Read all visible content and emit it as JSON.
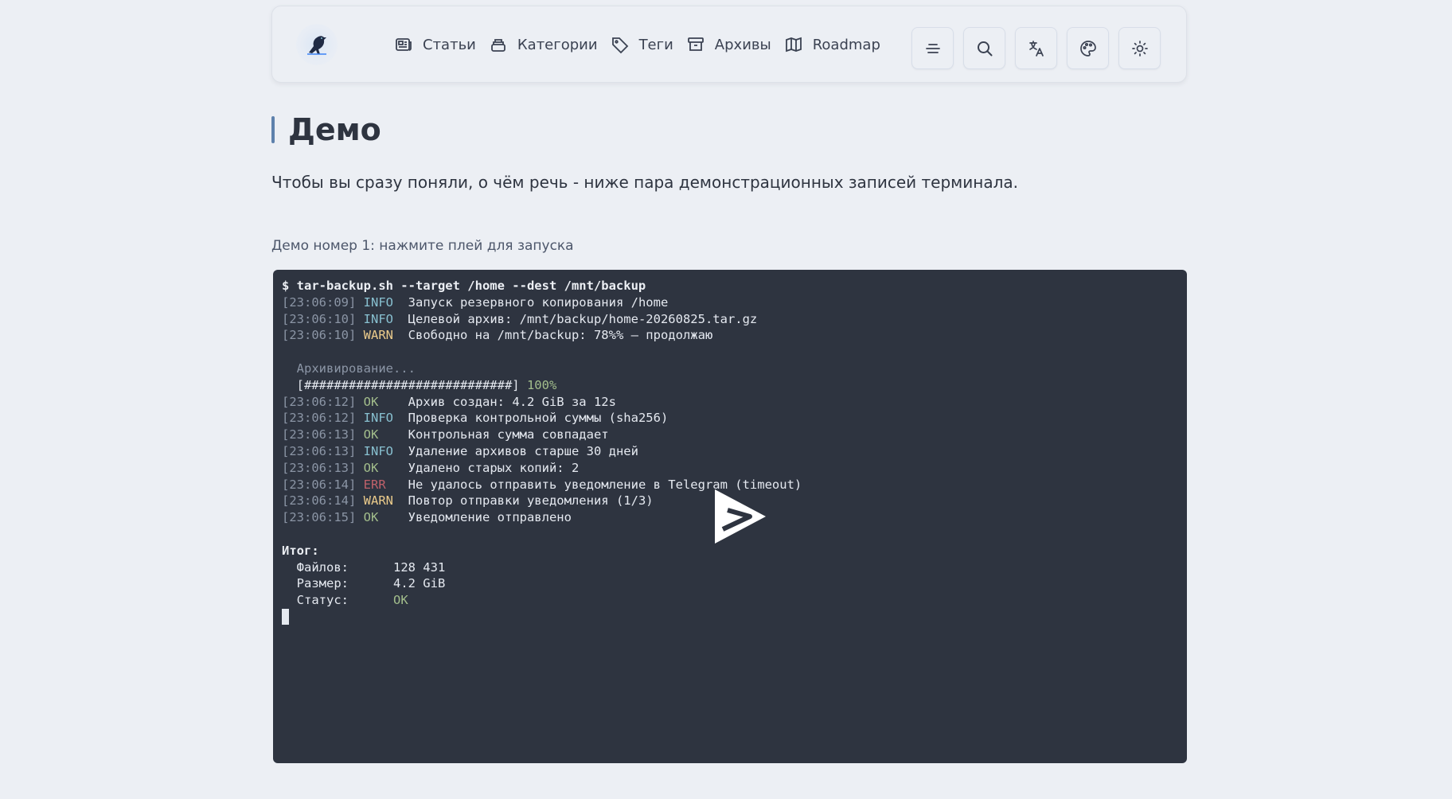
{
  "nav": {
    "items": [
      {
        "label": "Статьи",
        "icon": "article-icon"
      },
      {
        "label": "Категории",
        "icon": "stack-icon"
      },
      {
        "label": "Теги",
        "icon": "tag-icon"
      },
      {
        "label": "Архивы",
        "icon": "archive-icon"
      },
      {
        "label": "Roadmap",
        "icon": "map-icon"
      }
    ]
  },
  "tools": [
    "menu-lines-icon",
    "search-icon",
    "translate-icon",
    "palette-icon",
    "sun-icon"
  ],
  "page": {
    "title": "Демо",
    "lead": "Чтобы вы сразу поняли, о чём речь - ниже пара демонстрационных записей терминала.",
    "demo_caption": "Демо номер 1: нажмите плей для запуска"
  },
  "terminal": {
    "command": "$ tar-backup.sh --target /home --dest /mnt/backup",
    "log1": [
      {
        "ts": "[23:06:09]",
        "level": "INFO",
        "cls": "info",
        "msg": "Запуск резервного копирования /home"
      },
      {
        "ts": "[23:06:10]",
        "level": "INFO",
        "cls": "info",
        "msg": "Целевой архив: /mnt/backup/home-20260825.tar.gz"
      },
      {
        "ts": "[23:06:10]",
        "level": "WARN",
        "cls": "warn",
        "msg": "Свободно на /mnt/backup: 78%% — продолжаю"
      }
    ],
    "archiving": "  Архивирование...",
    "progress_bar": "  [############################]",
    "progress_pct": "100%",
    "log2": [
      {
        "ts": "[23:06:12]",
        "level": "OK",
        "cls": "ok",
        "msg": "Архив создан: 4.2 GiB за 12s"
      },
      {
        "ts": "[23:06:12]",
        "level": "INFO",
        "cls": "info",
        "msg": "Проверка контрольной суммы (sha256)"
      },
      {
        "ts": "[23:06:13]",
        "level": "OK",
        "cls": "ok",
        "msg": "Контрольная сумма совпадает"
      },
      {
        "ts": "[23:06:13]",
        "level": "INFO",
        "cls": "info",
        "msg": "Удаление архивов старше 30 дней"
      },
      {
        "ts": "[23:06:13]",
        "level": "OK",
        "cls": "ok",
        "msg": "Удалено старых копий: 2"
      },
      {
        "ts": "[23:06:14]",
        "level": "ERR",
        "cls": "err",
        "msg": "Не удалось отправить уведомление в Telegram (timeout)"
      },
      {
        "ts": "[23:06:14]",
        "level": "WARN",
        "cls": "warn",
        "msg": "Повтор отправки уведомления (1/3)"
      },
      {
        "ts": "[23:06:15]",
        "level": "OK",
        "cls": "ok",
        "msg": "Уведомление отправлено"
      }
    ],
    "summary_title": "Итог:",
    "summary": [
      {
        "label": "  Файлов:      ",
        "value": "128 431",
        "cls": ""
      },
      {
        "label": "  Размер:      ",
        "value": "4.2 GiB",
        "cls": ""
      },
      {
        "label": "  Статус:      ",
        "value": "OK",
        "cls": "ok"
      }
    ]
  },
  "colors": {
    "bg": "#eceff4",
    "terminal_bg": "#2e3440",
    "accent": "#5e81ac",
    "info": "#88c0d0",
    "warn": "#ebcb8b",
    "ok": "#a3be8c",
    "err": "#bf616a"
  }
}
